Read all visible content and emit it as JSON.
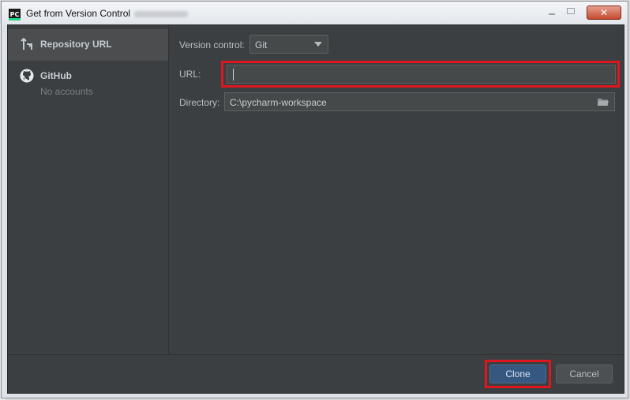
{
  "window": {
    "title": "Get from Version Control",
    "app_icon": "pycharm-icon",
    "app_icon_text": "PC",
    "close_glyph": "✕"
  },
  "sidebar": {
    "items": [
      {
        "label": "Repository URL",
        "icon": "vcs-arrow-icon",
        "selected": true
      },
      {
        "label": "GitHub",
        "sub": "No accounts",
        "icon": "github-icon",
        "selected": false
      }
    ]
  },
  "form": {
    "version_control": {
      "label": "Version control:",
      "value": "Git"
    },
    "url": {
      "label": "URL:",
      "value": ""
    },
    "directory": {
      "label": "Directory:",
      "value": "C:\\pycharm-workspace"
    }
  },
  "buttons": {
    "clone": "Clone",
    "cancel": "Cancel"
  },
  "colors": {
    "background": "#3c3f41",
    "accent": "#365880",
    "highlight": "#e0161e"
  }
}
